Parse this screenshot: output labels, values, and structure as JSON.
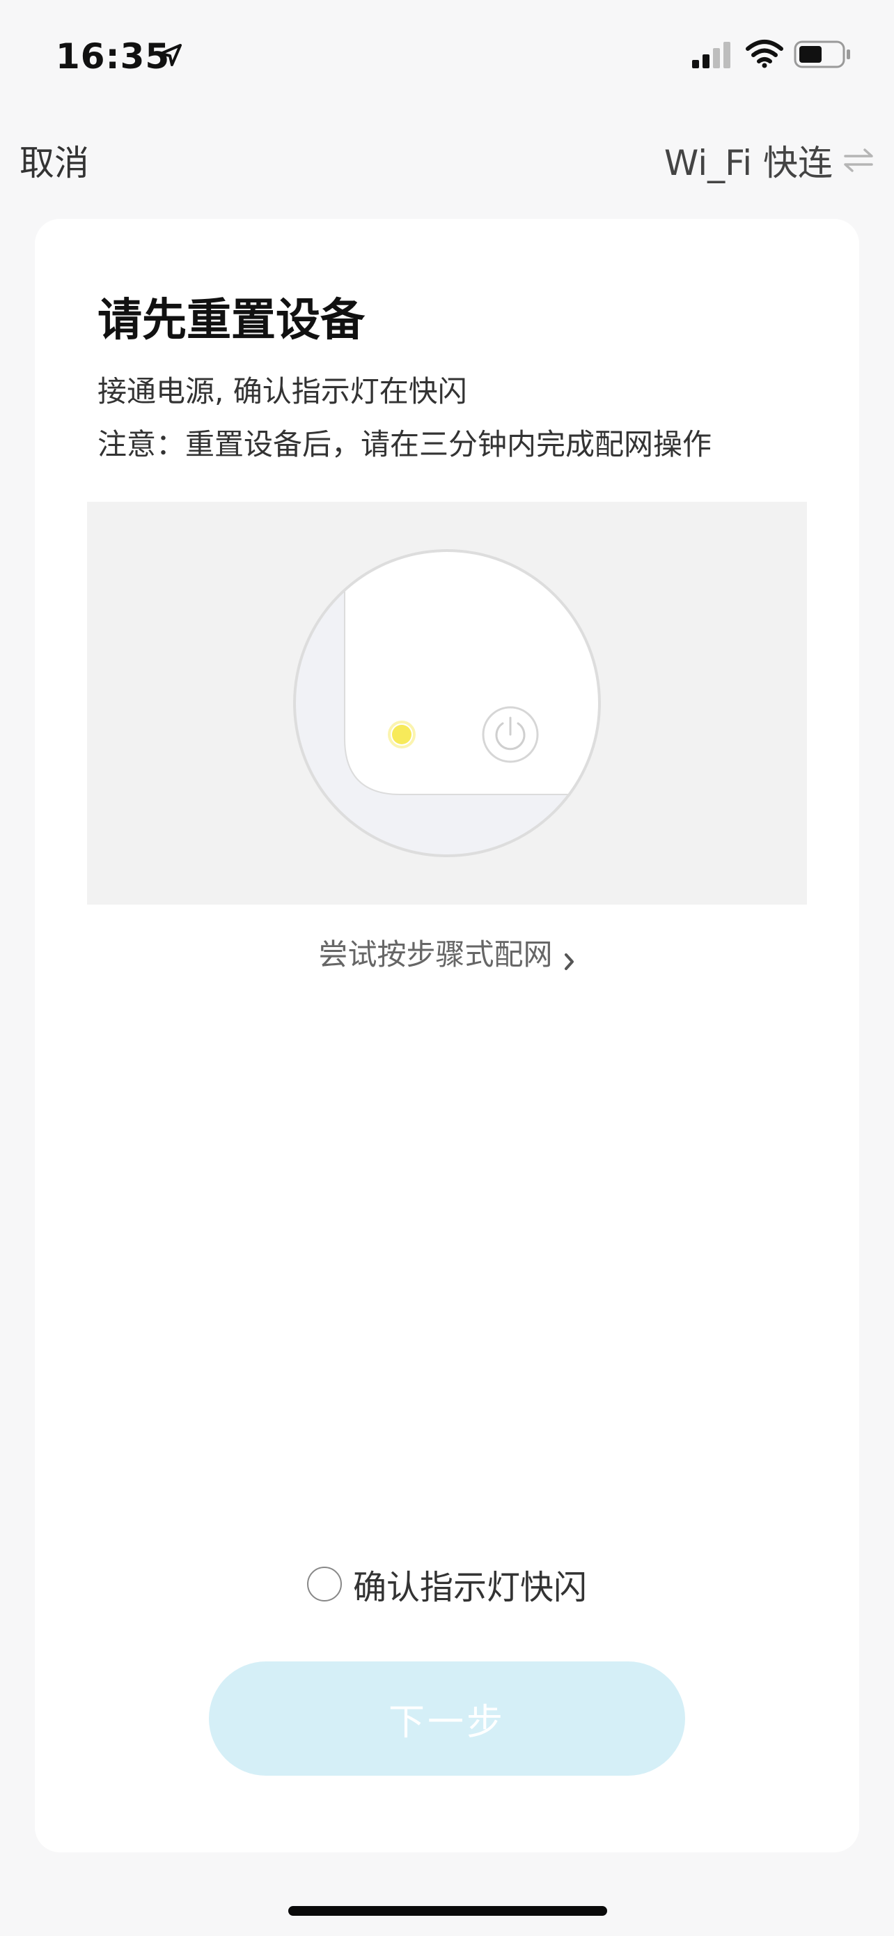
{
  "status_bar": {
    "time": "16:35",
    "icons": [
      "location-arrow-icon",
      "cellular-signal-icon",
      "wifi-icon",
      "battery-icon"
    ]
  },
  "nav": {
    "cancel_label": "取消",
    "mode_label": "Wi_Fi 快连",
    "mode_icon": "swap-arrows-icon"
  },
  "card": {
    "title": "请先重置设备",
    "description_line1": "接通电源, 确认指示灯在快闪",
    "description_line2": "注意：重置设备后，请在三分钟内完成配网操作",
    "illustration_icons": [
      "device-corner-illustration",
      "indicator-light-icon",
      "power-button-icon"
    ],
    "indicator_color": "#f7ea5a",
    "alt_method_link": "尝试按步骤式配网",
    "confirm_label": "确认指示灯快闪",
    "confirm_checked": false,
    "next_button_label": "下一步",
    "next_button_color": "#d5eff7"
  }
}
